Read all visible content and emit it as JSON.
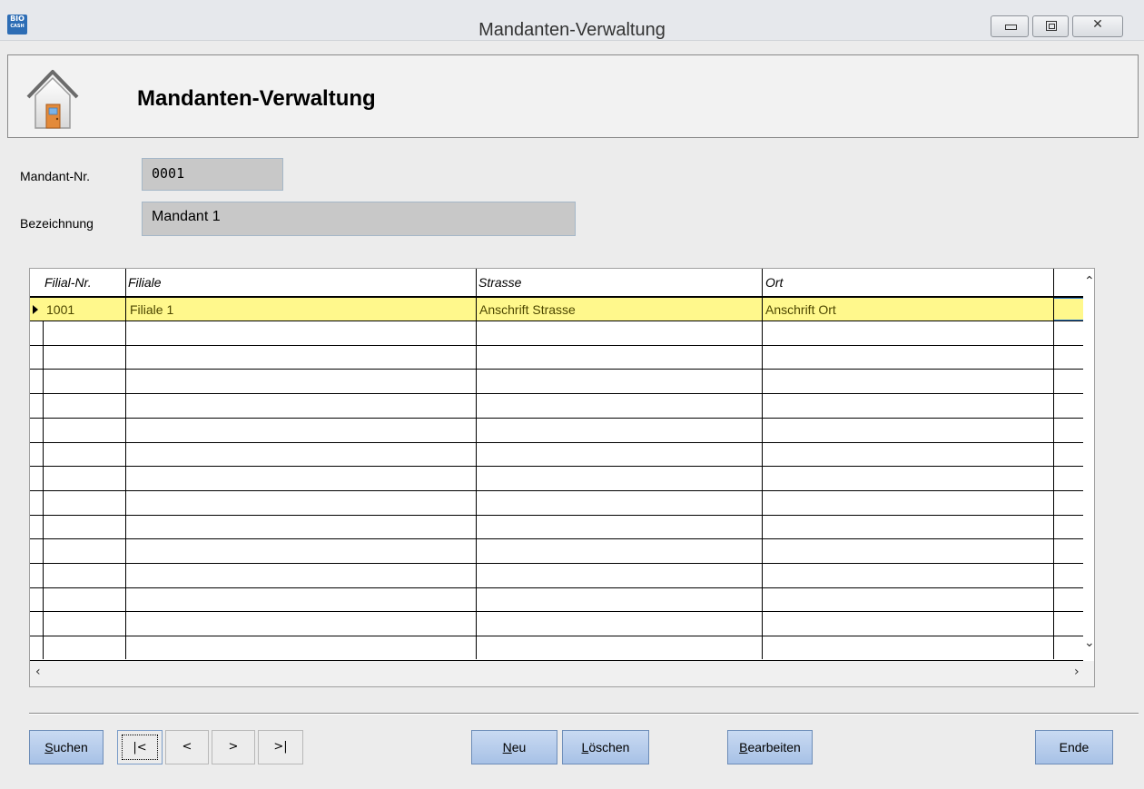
{
  "window": {
    "title": "Mandanten-Verwaltung",
    "app_icon_line1": "BIO",
    "app_icon_line2": "CASH"
  },
  "header": {
    "title": "Mandanten-Verwaltung",
    "icon": "home-icon"
  },
  "form": {
    "mandant_nr_label": "Mandant-Nr.",
    "mandant_nr_value": "0001",
    "bezeichnung_label": "Bezeichnung",
    "bezeichnung_value": "Mandant 1"
  },
  "grid": {
    "columns": [
      "Filial-Nr.",
      "Filiale",
      "Strasse",
      "Ort"
    ],
    "rows": [
      [
        "1001",
        "Filiale 1",
        "Anschrift Strasse",
        "Anschrift Ort"
      ]
    ],
    "selected_row": 0
  },
  "toolbar": {
    "search": {
      "prefix": "S",
      "rest": "uchen"
    },
    "first": "|<",
    "prev": "<",
    "next": ">",
    "last": ">|",
    "new": {
      "prefix": "N",
      "rest": "eu"
    },
    "delete": {
      "prefix": "L",
      "rest": "öschen"
    },
    "edit": {
      "prefix": "B",
      "rest": "earbeiten"
    },
    "end": "Ende"
  },
  "colors": {
    "selected_row": "#fff88c",
    "button": "#b8cdeb",
    "field": "#c8c8c8"
  }
}
